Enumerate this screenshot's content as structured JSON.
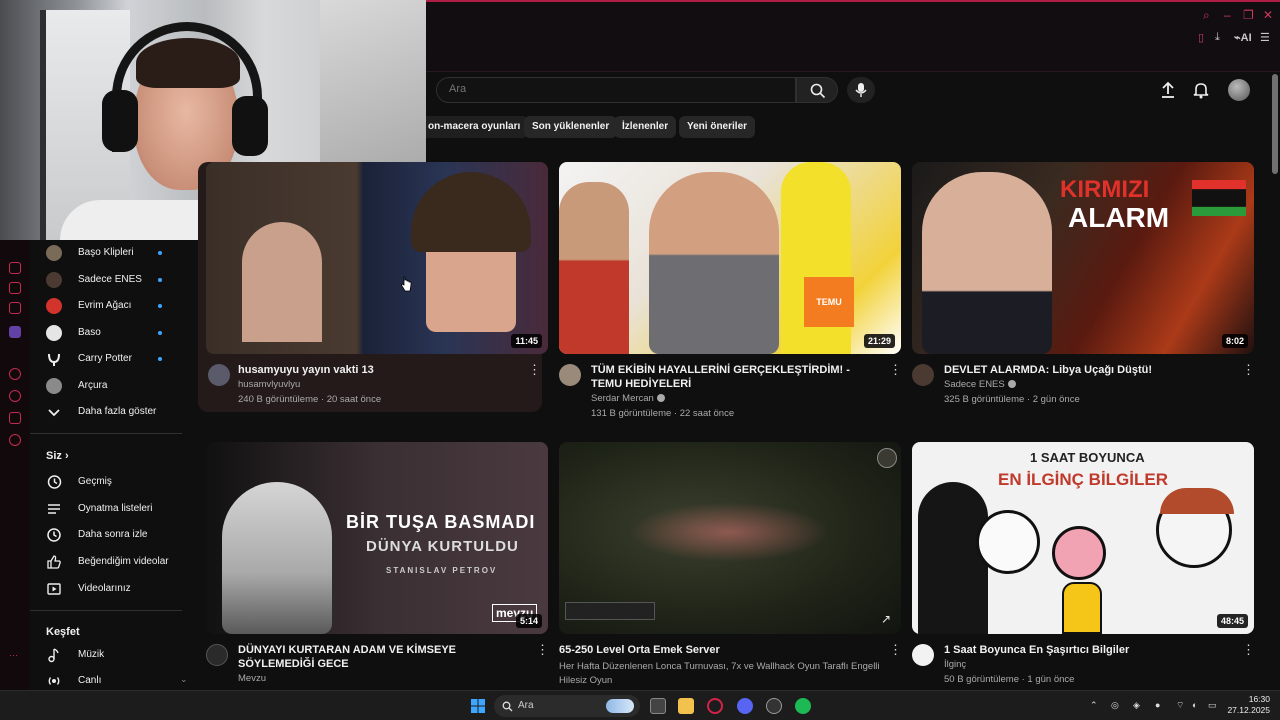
{
  "browser": {
    "window_controls": [
      "⌕",
      "–",
      "❐",
      "✕"
    ],
    "toolbar_ai_label": "AI"
  },
  "header": {
    "search_placeholder": "Ara"
  },
  "chips": [
    "on-macera oyunları",
    "Son yüklenenler",
    "İzlenenler",
    "Yeni öneriler"
  ],
  "sidebar": {
    "subscriptions": [
      {
        "label": "Başo Klipleri",
        "color": "#7a6a58"
      },
      {
        "label": "Sadece ENES",
        "color": "#4a3a32"
      },
      {
        "label": "Evrim Ağacı",
        "color": "#d2332b"
      },
      {
        "label": "Baso",
        "color": "#e5e5e5"
      },
      {
        "label": "Carry Potter",
        "color": "#3a3a3a"
      },
      {
        "label": "Arçura",
        "color": "#8a8a8a"
      }
    ],
    "show_more": "Daha fazla göster",
    "you_title": "Siz",
    "you_items": [
      "Geçmiş",
      "Oynatma listeleri",
      "Daha sonra izle",
      "Beğendiğim videolar",
      "Videolarınız"
    ],
    "explore_title": "Keşfet",
    "explore_items": [
      "Müzik",
      "Canlı"
    ]
  },
  "videos": [
    {
      "title": "husamyuyu yayın vakti 13",
      "channel": "husamvlyuvlyu",
      "meta": "240 B görüntüleme · 20 saat önce",
      "duration": "11:45",
      "verified": false,
      "avatar_color": "#5a5a6a"
    },
    {
      "title": "TÜM EKİBİN HAYALLERİNİ GERÇEKLEŞTİRDİM! - TEMU HEDİYELERİ",
      "channel": "Serdar Mercan",
      "meta": "131 B görüntüleme · 22 saat önce",
      "duration": "21:29",
      "verified": true,
      "avatar_color": "#9a8a7a"
    },
    {
      "title": "DEVLET ALARMDA: Libya Uçağı Düştü!",
      "channel": "Sadece ENES",
      "meta": "325 B görüntüleme · 2 gün önce",
      "duration": "8:02",
      "verified": true,
      "avatar_color": "#4a3a32"
    },
    {
      "title": "DÜNYAYI KURTARAN ADAM VE KİMSEYE SÖYLEMEDİĞİ GECE",
      "channel": "Mevzu",
      "meta": "",
      "duration": "5:14",
      "verified": false,
      "avatar_color": "#2a2a2a"
    },
    {
      "title": "65-250 Level Orta Emek Server",
      "channel": "Her Hafta Düzenlenen Lonca Turnuvası, 7x ve Wallhack Oyun Taraflı Engelli",
      "meta": "Hilesiz Oyun",
      "duration": "",
      "verified": false,
      "avatar_color": ""
    },
    {
      "title": "1 Saat Boyunca En Şaşırtıcı Bilgiler",
      "channel": "İlginç",
      "meta": "50 B görüntüleme · 1 gün önce",
      "duration": "48:45",
      "verified": false,
      "avatar_color": "#f2f2f2"
    }
  ],
  "thumb_text": {
    "v3_line1": "KIRMIZI",
    "v3_line2": "ALARM",
    "v4_line1": "BİR TUŞA BASMADI",
    "v4_line2": "DÜNYA KURTULDU",
    "v4_line3": "STANISLAV PETROV",
    "v4_logo": "mevzu",
    "v6_line1": "1 SAAT BOYUNCA",
    "v6_line2": "EN İLGİNÇ BİLGİLER",
    "v2_badge": "TEMU"
  },
  "taskbar": {
    "search_label": "Ara",
    "time": "16:30",
    "date": "27.12.2025"
  }
}
